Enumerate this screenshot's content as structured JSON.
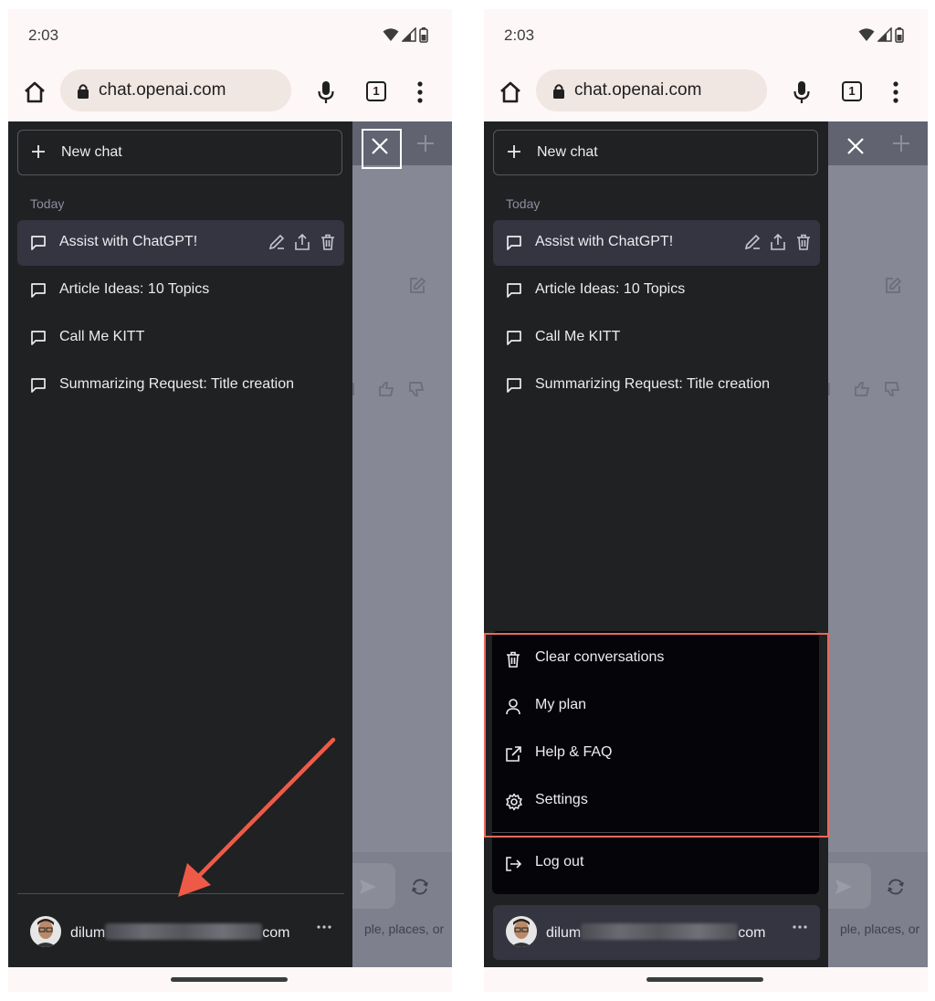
{
  "colors": {
    "sidebar_bg": "#202123",
    "active_bg": "#343541",
    "highlight": "#e9695c",
    "arrow": "#ef5a48"
  },
  "panels": [
    {
      "status": {
        "time": "2:03",
        "icons": [
          "wifi-icon",
          "signal-icon",
          "battery-icon"
        ]
      },
      "browser": {
        "url": "chat.openai.com",
        "tab_count": "1"
      },
      "sidebar": {
        "new_chat_label": "New chat",
        "section_label": "Today",
        "conversations": [
          "Assist with ChatGPT!",
          "Article Ideas: 10 Topics",
          "Call Me KITT",
          "Summarizing Request: Title creation"
        ],
        "user": {
          "name_start": "dilum",
          "name_end": "com"
        }
      },
      "background": {
        "hint": "ple, places, or"
      }
    },
    {
      "status": {
        "time": "2:03",
        "icons": [
          "wifi-icon",
          "signal-icon",
          "battery-icon"
        ]
      },
      "browser": {
        "url": "chat.openai.com",
        "tab_count": "1"
      },
      "sidebar": {
        "new_chat_label": "New chat",
        "section_label": "Today",
        "conversations": [
          "Assist with ChatGPT!",
          "Article Ideas: 10 Topics",
          "Call Me KITT",
          "Summarizing Request: Title creation"
        ],
        "user": {
          "name_start": "dilum",
          "name_end": "com"
        },
        "menu": [
          "Clear conversations",
          "My plan",
          "Help & FAQ",
          "Settings",
          "Log out"
        ]
      },
      "background": {
        "hint": "ple, places, or"
      }
    }
  ]
}
